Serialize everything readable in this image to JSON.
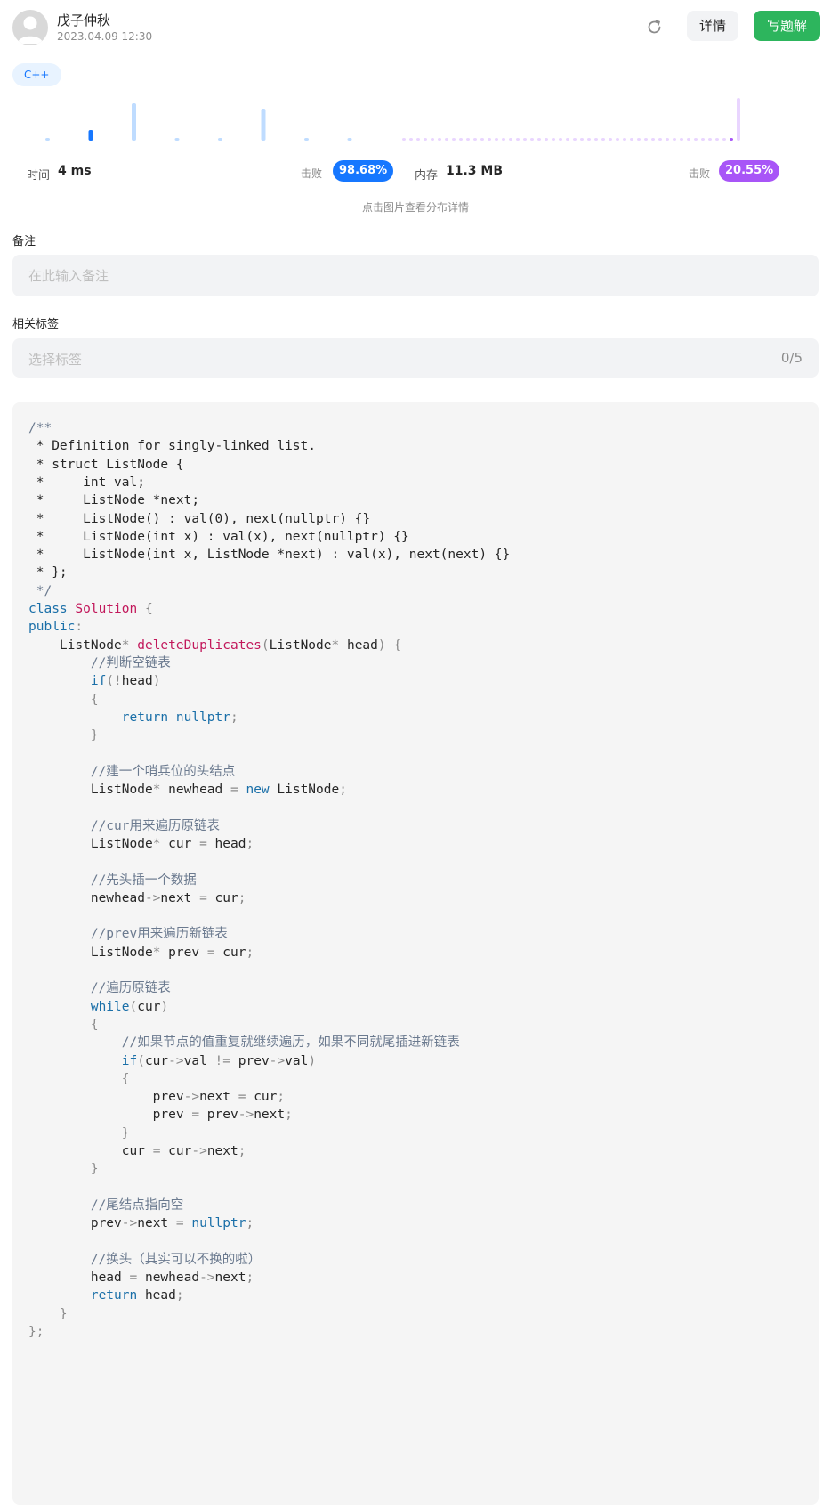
{
  "header": {
    "user_name": "戊子仲秋",
    "timestamp": "2023.04.09 12:30",
    "refresh_icon": "refresh-icon",
    "detail_label": "详情",
    "write_solution_label": "写题解"
  },
  "language_tag": "C++",
  "runtime": {
    "label": "时间",
    "value": "4 ms",
    "beat_label": "击败",
    "beat_percent": "98.68%",
    "accent": "#1677ff"
  },
  "memory": {
    "label": "内存",
    "value": "11.3 MB",
    "beat_label": "击败",
    "beat_percent": "20.55%",
    "accent": "#a855f7"
  },
  "chart_hint": "点击图片查看分布详情",
  "notes": {
    "label": "备注",
    "placeholder": "在此输入备注"
  },
  "tags": {
    "label": "相关标签",
    "placeholder": "选择标签",
    "count": "0/5"
  },
  "chart_data": [
    {
      "type": "bar",
      "title": "",
      "categories": [
        "1",
        "2",
        "3",
        "4",
        "5",
        "6",
        "7",
        "8"
      ],
      "values": [
        1,
        6,
        21,
        1,
        1,
        18,
        1,
        1
      ],
      "highlight_index": 1,
      "colors": {
        "bar": "#bfdcff",
        "highlight": "#1677ff"
      }
    },
    {
      "type": "bar",
      "title": "",
      "bar_count": 48,
      "values": [
        1,
        1,
        1,
        1,
        1,
        1,
        1,
        1,
        1,
        1,
        1,
        1,
        1,
        1,
        1,
        1,
        1,
        1,
        1,
        1,
        1,
        1,
        1,
        1,
        1,
        1,
        1,
        1,
        1,
        1,
        1,
        1,
        1,
        1,
        1,
        1,
        1,
        1,
        1,
        1,
        1,
        1,
        1,
        1,
        1,
        1,
        1,
        20
      ],
      "highlight_index": 46,
      "colors": {
        "bar": "#e9d5ff",
        "highlight": "#a855f7"
      }
    }
  ],
  "code": {
    "language": "cpp",
    "lines": [
      [
        [
          "c",
          "/**"
        ]
      ],
      [
        [
          "p",
          " * Definition for singly-linked list."
        ]
      ],
      [
        [
          "p",
          " * struct ListNode {"
        ]
      ],
      [
        [
          "p",
          " *     int val;"
        ]
      ],
      [
        [
          "p",
          " *     ListNode *next;"
        ]
      ],
      [
        [
          "p",
          " *     ListNode() : val(0), next(nullptr) {}"
        ]
      ],
      [
        [
          "p",
          " *     ListNode(int x) : val(x), next(nullptr) {}"
        ]
      ],
      [
        [
          "p",
          " *     ListNode(int x, ListNode *next) : val(x), next(next) {}"
        ]
      ],
      [
        [
          "p",
          " * };"
        ]
      ],
      [
        [
          "c",
          " */"
        ]
      ],
      [
        [
          "k",
          "class "
        ],
        [
          "s",
          "Solution"
        ],
        [
          "u",
          " {"
        ]
      ],
      [
        [
          "k",
          "public"
        ],
        [
          "u",
          ":"
        ]
      ],
      [
        [
          "p",
          "    ListNode"
        ],
        [
          "u",
          "* "
        ],
        [
          "f",
          "deleteDuplicates"
        ],
        [
          "u",
          "("
        ],
        [
          "p",
          "ListNode"
        ],
        [
          "u",
          "* "
        ],
        [
          "p",
          "head"
        ],
        [
          "u",
          ") {"
        ]
      ],
      [
        [
          "c",
          "        //判断空链表"
        ]
      ],
      [
        [
          "k",
          "        if"
        ],
        [
          "u",
          "(!"
        ],
        [
          "p",
          "head"
        ],
        [
          "u",
          ")"
        ]
      ],
      [
        [
          "u",
          "        {"
        ]
      ],
      [
        [
          "k",
          "            return nullptr"
        ],
        [
          "u",
          ";"
        ]
      ],
      [
        [
          "u",
          "        }"
        ]
      ],
      [
        [
          "p",
          ""
        ]
      ],
      [
        [
          "c",
          "        //建一个哨兵位的头结点"
        ]
      ],
      [
        [
          "p",
          "        ListNode"
        ],
        [
          "u",
          "* "
        ],
        [
          "p",
          "newhead "
        ],
        [
          "u",
          "= "
        ],
        [
          "k",
          "new "
        ],
        [
          "p",
          "ListNode"
        ],
        [
          "u",
          ";"
        ]
      ],
      [
        [
          "p",
          ""
        ]
      ],
      [
        [
          "c",
          "        //cur用来遍历原链表"
        ]
      ],
      [
        [
          "p",
          "        ListNode"
        ],
        [
          "u",
          "* "
        ],
        [
          "p",
          "cur "
        ],
        [
          "u",
          "= "
        ],
        [
          "p",
          "head"
        ],
        [
          "u",
          ";"
        ]
      ],
      [
        [
          "p",
          ""
        ]
      ],
      [
        [
          "c",
          "        //先头插一个数据"
        ]
      ],
      [
        [
          "p",
          "        newhead"
        ],
        [
          "u",
          "->"
        ],
        [
          "p",
          "next "
        ],
        [
          "u",
          "= "
        ],
        [
          "p",
          "cur"
        ],
        [
          "u",
          ";"
        ]
      ],
      [
        [
          "p",
          ""
        ]
      ],
      [
        [
          "c",
          "        //prev用来遍历新链表"
        ]
      ],
      [
        [
          "p",
          "        ListNode"
        ],
        [
          "u",
          "* "
        ],
        [
          "p",
          "prev "
        ],
        [
          "u",
          "= "
        ],
        [
          "p",
          "cur"
        ],
        [
          "u",
          ";"
        ]
      ],
      [
        [
          "p",
          ""
        ]
      ],
      [
        [
          "c",
          "        //遍历原链表"
        ]
      ],
      [
        [
          "k",
          "        while"
        ],
        [
          "u",
          "("
        ],
        [
          "p",
          "cur"
        ],
        [
          "u",
          ")"
        ]
      ],
      [
        [
          "u",
          "        {"
        ]
      ],
      [
        [
          "c",
          "            //如果节点的值重复就继续遍历，如果不同就尾插进新链表"
        ]
      ],
      [
        [
          "k",
          "            if"
        ],
        [
          "u",
          "("
        ],
        [
          "p",
          "cur"
        ],
        [
          "u",
          "->"
        ],
        [
          "p",
          "val "
        ],
        [
          "u",
          "!= "
        ],
        [
          "p",
          "prev"
        ],
        [
          "u",
          "->"
        ],
        [
          "p",
          "val"
        ],
        [
          "u",
          ")"
        ]
      ],
      [
        [
          "u",
          "            {"
        ]
      ],
      [
        [
          "p",
          "                prev"
        ],
        [
          "u",
          "->"
        ],
        [
          "p",
          "next "
        ],
        [
          "u",
          "= "
        ],
        [
          "p",
          "cur"
        ],
        [
          "u",
          ";"
        ]
      ],
      [
        [
          "p",
          "                prev "
        ],
        [
          "u",
          "= "
        ],
        [
          "p",
          "prev"
        ],
        [
          "u",
          "->"
        ],
        [
          "p",
          "next"
        ],
        [
          "u",
          ";"
        ]
      ],
      [
        [
          "u",
          "            }"
        ]
      ],
      [
        [
          "p",
          "            cur "
        ],
        [
          "u",
          "= "
        ],
        [
          "p",
          "cur"
        ],
        [
          "u",
          "->"
        ],
        [
          "p",
          "next"
        ],
        [
          "u",
          ";"
        ]
      ],
      [
        [
          "u",
          "        }"
        ]
      ],
      [
        [
          "p",
          ""
        ]
      ],
      [
        [
          "c",
          "        //尾结点指向空"
        ]
      ],
      [
        [
          "p",
          "        prev"
        ],
        [
          "u",
          "->"
        ],
        [
          "p",
          "next "
        ],
        [
          "u",
          "= "
        ],
        [
          "k",
          "nullptr"
        ],
        [
          "u",
          ";"
        ]
      ],
      [
        [
          "p",
          ""
        ]
      ],
      [
        [
          "c",
          "        //换头（其实可以不换的啦）"
        ]
      ],
      [
        [
          "p",
          "        head "
        ],
        [
          "u",
          "= "
        ],
        [
          "p",
          "newhead"
        ],
        [
          "u",
          "->"
        ],
        [
          "p",
          "next"
        ],
        [
          "u",
          ";"
        ]
      ],
      [
        [
          "k",
          "        return "
        ],
        [
          "p",
          "head"
        ],
        [
          "u",
          ";"
        ]
      ],
      [
        [
          "u",
          "    }"
        ]
      ],
      [
        [
          "u",
          "};"
        ]
      ]
    ]
  }
}
